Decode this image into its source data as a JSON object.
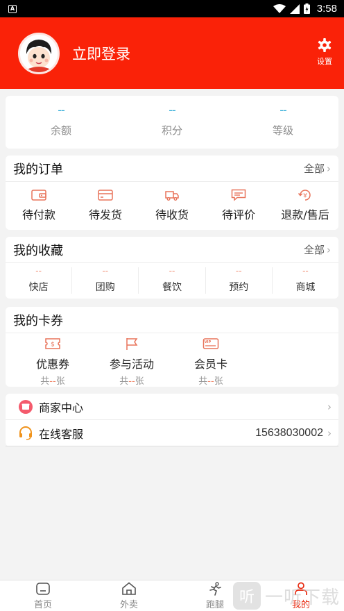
{
  "status_bar": {
    "app_badge": "A",
    "time": "3:58"
  },
  "header": {
    "login_text": "立即登录",
    "settings_label": "设置"
  },
  "stats": [
    {
      "value": "--",
      "label": "余额"
    },
    {
      "value": "--",
      "label": "积分"
    },
    {
      "value": "--",
      "label": "等级"
    }
  ],
  "orders": {
    "title": "我的订单",
    "more": "全部",
    "items": [
      {
        "label": "待付款",
        "icon": "wallet-icon"
      },
      {
        "label": "待发货",
        "icon": "card-icon"
      },
      {
        "label": "待收货",
        "icon": "truck-icon"
      },
      {
        "label": "待评价",
        "icon": "comment-icon"
      },
      {
        "label": "退款/售后",
        "icon": "refund-icon"
      }
    ]
  },
  "favorites": {
    "title": "我的收藏",
    "more": "全部",
    "items": [
      {
        "value": "--",
        "label": "快店"
      },
      {
        "value": "--",
        "label": "团购"
      },
      {
        "value": "--",
        "label": "餐饮"
      },
      {
        "value": "--",
        "label": "预约"
      },
      {
        "value": "--",
        "label": "商城"
      }
    ]
  },
  "cards": {
    "title": "我的卡券",
    "items": [
      {
        "label": "优惠券",
        "count_prefix": "共",
        "count": "--",
        "count_suffix": "张",
        "icon": "coupon-icon"
      },
      {
        "label": "参与活动",
        "count_prefix": "共",
        "count": "--",
        "count_suffix": "张",
        "icon": "flag-icon"
      },
      {
        "label": "会员卡",
        "count_prefix": "共",
        "count": "--",
        "count_suffix": "张",
        "icon": "vip-card-icon",
        "icon_text": "VIP"
      }
    ]
  },
  "list": {
    "merchant_center": "商家中心",
    "online_service": "在线客服",
    "service_phone": "15638030002"
  },
  "tabs": [
    {
      "label": "首页",
      "icon": "home-icon"
    },
    {
      "label": "外卖",
      "icon": "takeout-icon"
    },
    {
      "label": "跑腿",
      "icon": "runner-icon"
    },
    {
      "label": "我的",
      "icon": "profile-icon",
      "active": true
    }
  ],
  "watermark": {
    "badge": "听",
    "text": "一听下载"
  },
  "colors": {
    "primary": "#fa2208",
    "accent_orange": "#f08a6e",
    "stat_blue": "#2aa9d6",
    "background": "#f3f3f3"
  }
}
